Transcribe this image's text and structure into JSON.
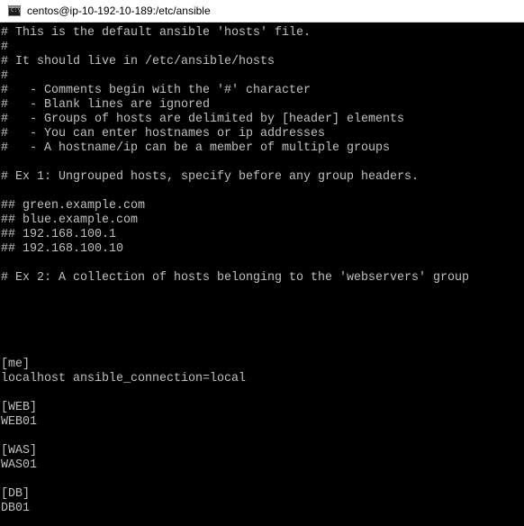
{
  "window": {
    "title": "centos@ip-10-192-10-189:/etc/ansible",
    "icon": "console-icon"
  },
  "colors": {
    "terminal_bg": "#000000",
    "terminal_fg": "#c0c0c0",
    "titlebar_bg": "#ffffff"
  },
  "lines": [
    "# This is the default ansible 'hosts' file.",
    "#",
    "# It should live in /etc/ansible/hosts",
    "#",
    "#   - Comments begin with the '#' character",
    "#   - Blank lines are ignored",
    "#   - Groups of hosts are delimited by [header] elements",
    "#   - You can enter hostnames or ip addresses",
    "#   - A hostname/ip can be a member of multiple groups",
    "",
    "# Ex 1: Ungrouped hosts, specify before any group headers.",
    "",
    "## green.example.com",
    "## blue.example.com",
    "## 192.168.100.1",
    "## 192.168.100.10",
    "",
    "# Ex 2: A collection of hosts belonging to the 'webservers' group",
    "",
    "",
    "",
    "",
    "",
    "[me]",
    "localhost ansible_connection=local",
    "",
    "[WEB]",
    "WEB01",
    "",
    "[WAS]",
    "WAS01",
    "",
    "[DB]",
    "DB01"
  ]
}
